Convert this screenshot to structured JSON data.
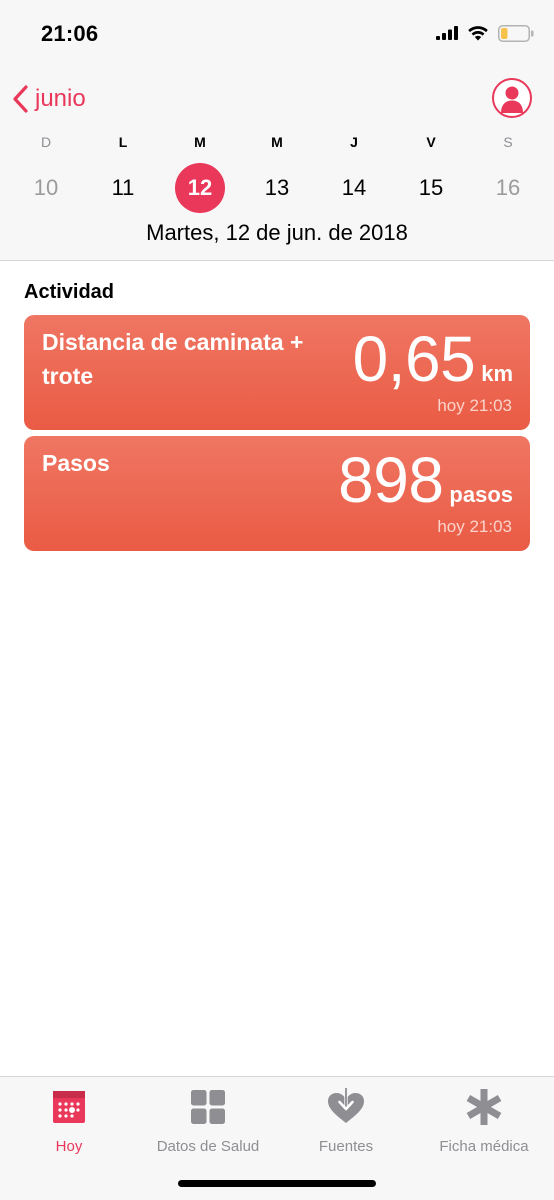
{
  "status_bar": {
    "time": "21:06",
    "icons": [
      "cellular-signal-icon",
      "wifi-icon",
      "battery-icon"
    ],
    "battery_level": 0.25
  },
  "header": {
    "back_label": "junio",
    "profile_icon": "person-icon",
    "weekdays": [
      "D",
      "L",
      "M",
      "M",
      "J",
      "V",
      "S"
    ],
    "days": [
      "10",
      "11",
      "12",
      "13",
      "14",
      "15",
      "16"
    ],
    "selected_day": "12",
    "full_date": "Martes, 12 de jun. de 2018"
  },
  "section": {
    "title": "Actividad"
  },
  "cards": [
    {
      "title": "Distancia de caminata + trote",
      "value": "0,65",
      "unit": "km",
      "time": "hoy 21:03"
    },
    {
      "title": "Pasos",
      "value": "898",
      "unit": "pasos",
      "time": "hoy 21:03"
    }
  ],
  "tab_bar": {
    "tabs": [
      {
        "label": "Hoy",
        "icon": "calendar-icon",
        "active": true
      },
      {
        "label": "Datos de Salud",
        "icon": "grid-icon",
        "active": false
      },
      {
        "label": "Fuentes",
        "icon": "heart-download-icon",
        "active": false
      },
      {
        "label": "Ficha médica",
        "icon": "asterisk-icon",
        "active": false
      }
    ]
  },
  "colors": {
    "accent": "#e9385a",
    "card_top": "#ef7663",
    "card_bottom": "#ea5b44",
    "inactive_tab": "#8e8e93"
  }
}
